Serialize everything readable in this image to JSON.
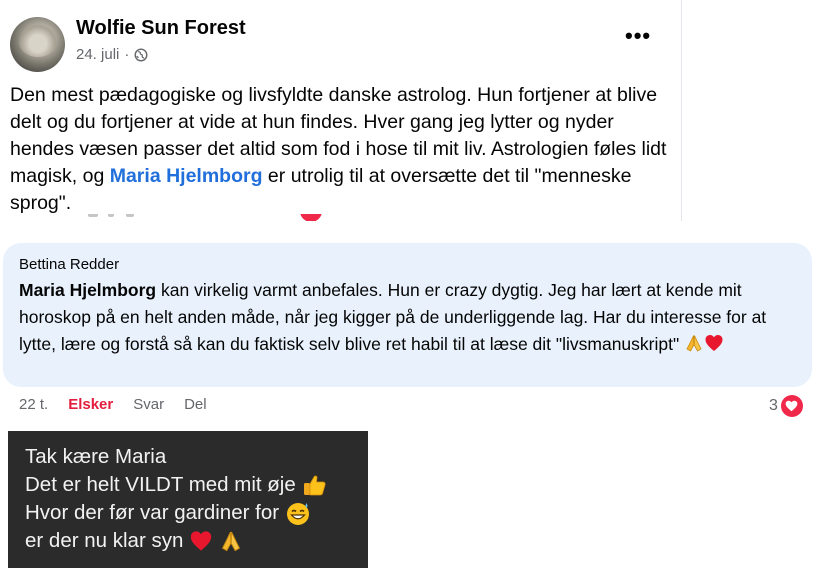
{
  "post": {
    "author": "Wolfie Sun Forest",
    "date": "24. juli",
    "date_separator": "·",
    "more_label": "•••",
    "text_before": "Den mest pædagogiske og livsfyldte danske astrolog. Hun fortjener at blive delt og du fortjener at vide at hun findes. Hver gang jeg lytter og nyder hendes væsen passer det altid som fod i hose til mit liv. Astrologien føles lidt magisk, og ",
    "mention": "Maria Hjelmborg",
    "text_after": " er utrolig til at oversætte det til \"menneske sprog\".",
    "icons": {
      "privacy": "globe-icon",
      "menu": "more-options-icon"
    }
  },
  "comment": {
    "author": "Bettina Redder",
    "mention": "Maria Hjelmborg",
    "text": " kan virkelig varmt anbefales. Hun er crazy dygtig. Jeg har lært at kende mit horoskop på en helt anden måde, når jeg kigger på de underliggende lag. Har du interesse for at lytte, lære og forstå så kan du faktisk selv blive ret habil til at læse dit \"livsmanuskript\" ",
    "emojis": [
      "folded-hands-emoji",
      "red-heart-emoji"
    ],
    "time": "22 t.",
    "actions": {
      "love": "Elsker",
      "reply": "Svar",
      "share": "Del"
    },
    "reaction_count": "3",
    "reaction_icon": "heart-reaction-icon",
    "colors": {
      "bubble": "#e8f1fc",
      "love": "#e41e3f",
      "mention": "#216fdb"
    }
  },
  "message": {
    "lines": [
      {
        "text": "Tak kære Maria",
        "emoji": ""
      },
      {
        "text": "Det er helt VILDT med mit øje",
        "emoji": "thumbs-up-emoji"
      },
      {
        "text": "Hvor der før var gardiner for",
        "emoji": "grinning-sweat-emoji"
      },
      {
        "text": "er der nu klar syn",
        "emoji": "heart-and-folded-hands-emoji"
      }
    ],
    "colors": {
      "background": "#2b2b2b",
      "text": "#f2f2f2"
    }
  }
}
